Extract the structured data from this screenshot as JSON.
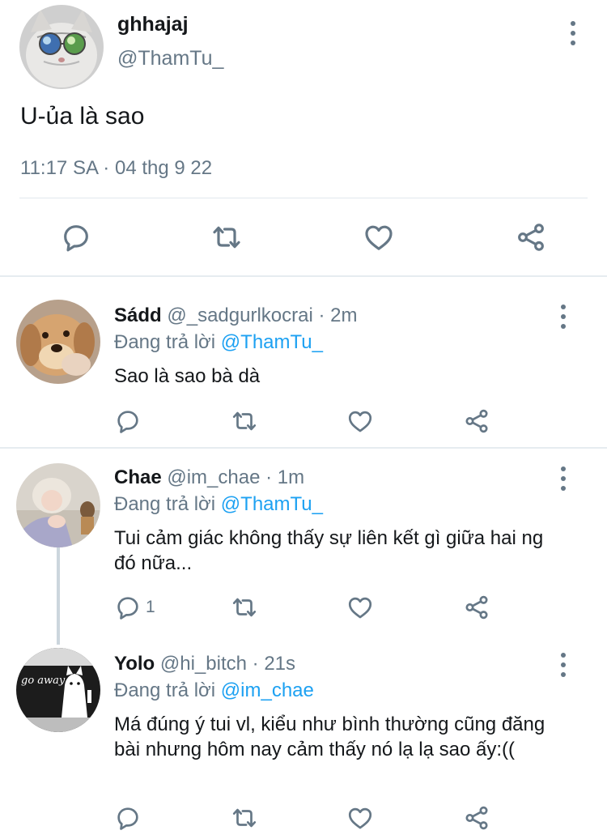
{
  "main_tweet": {
    "name": "ghhajaj",
    "handle": "@ThamTu_",
    "text": "U-ủa là sao",
    "timestamp": "11:17 SA · 04 thg 9 22",
    "actions": [
      "reply-icon",
      "retweet-icon",
      "like-icon",
      "share-icon"
    ]
  },
  "replies": [
    {
      "name": "Sádd",
      "handle": "@_sadgurlkocrai",
      "sep": "·",
      "time": "2m",
      "replying_prefix": "Đang trả lời",
      "replying_to": "@ThamTu_",
      "text": "Sao là sao bà dà"
    },
    {
      "name": "Chae",
      "handle": "@im_chae",
      "sep": "·",
      "time": "1m",
      "replying_prefix": "Đang trả lời",
      "replying_to": "@ThamTu_",
      "text": "Tui cảm giác không thấy sự liên kết gì giữa hai ng đó nữa...",
      "reply_count": "1"
    },
    {
      "name": "Yolo",
      "handle": "@hi_bitch",
      "sep": "·",
      "time": "21s",
      "replying_prefix": "Đang trả lời",
      "replying_to": "@im_chae",
      "text": "Má đúng ý tui vl, kiểu như bình thường cũng đăng bài nhưng hôm nay cảm thấy nó lạ lạ sao ấy:((",
      "avatar_text": "go away"
    }
  ],
  "colors": {
    "text": "#14171a",
    "secondary": "#657786",
    "link": "#1da1f2",
    "divider": "#e1e8ed"
  }
}
